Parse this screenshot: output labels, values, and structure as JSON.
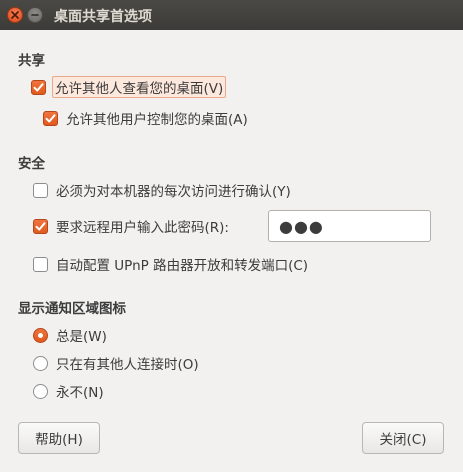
{
  "window": {
    "title": "桌面共享首选项"
  },
  "sharing": {
    "heading": "共享",
    "allow_view_label": "允许其他人查看您的桌面(V)",
    "allow_view_checked": true,
    "allow_control_label": "允许其他用户控制您的桌面(A)",
    "allow_control_checked": true
  },
  "security": {
    "heading": "安全",
    "confirm_label": "必须为对本机器的每次访问进行确认(Y)",
    "confirm_checked": false,
    "password_label": "要求远程用户输入此密码(R):",
    "password_checked": true,
    "password_value": "●●●",
    "upnp_label": "自动配置 UPnP 路由器开放和转发端口(C)",
    "upnp_checked": false
  },
  "notification": {
    "heading": "显示通知区域图标",
    "options": [
      {
        "label": "总是(W)",
        "selected": true
      },
      {
        "label": "只在有其他人连接时(O)",
        "selected": false
      },
      {
        "label": "永不(N)",
        "selected": false
      }
    ]
  },
  "buttons": {
    "help_label": "帮助(H)",
    "close_label": "关闭(C)"
  },
  "colors": {
    "accent": "#e05a1c",
    "titlebar": "#3c3b37",
    "background": "#f2f1f0"
  }
}
